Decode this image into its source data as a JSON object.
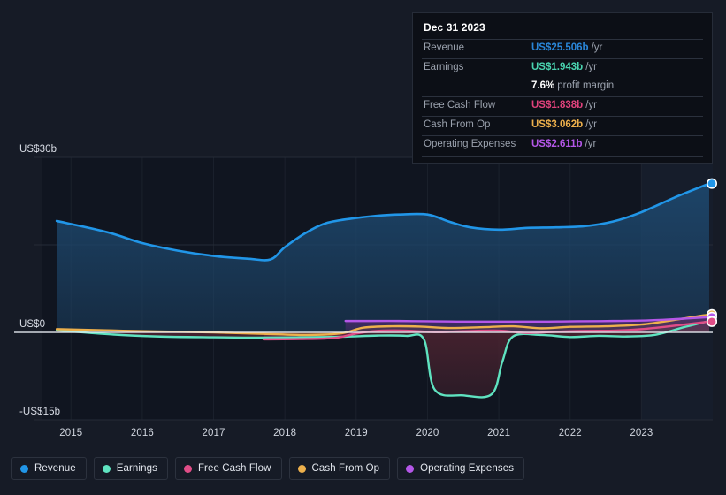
{
  "chart_data": {
    "type": "area",
    "title": "",
    "xlabel": "",
    "ylabel": "",
    "x_tick_labels": [
      "2015",
      "2016",
      "2017",
      "2018",
      "2019",
      "2020",
      "2021",
      "2022",
      "2023"
    ],
    "y_tick_labels": [
      "US$30b",
      "US$0",
      "-US$15b"
    ],
    "ylim": [
      -15,
      30
    ],
    "xlim": [
      2014.6,
      2024.0
    ],
    "grid": true,
    "legend_position": "bottom",
    "currency": "US$",
    "units": "billions",
    "series": [
      {
        "name": "Revenue",
        "color": "#2196e8",
        "fill": "#1d466b",
        "x": [
          2014.8,
          2015.5,
          2016.0,
          2016.5,
          2017.0,
          2017.5,
          2017.8,
          2018.0,
          2018.3,
          2018.6,
          2019.0,
          2019.3,
          2019.6,
          2020.0,
          2020.3,
          2020.6,
          2021.0,
          2021.4,
          2021.8,
          2022.2,
          2022.6,
          2023.0,
          2023.5,
          2023.95
        ],
        "values": [
          19.1,
          17.2,
          15.3,
          14.0,
          13.1,
          12.6,
          12.5,
          14.6,
          17.1,
          18.8,
          19.6,
          20.0,
          20.2,
          20.2,
          19.0,
          18.0,
          17.6,
          17.9,
          18.0,
          18.2,
          19.0,
          20.6,
          23.3,
          25.506
        ]
      },
      {
        "name": "Earnings",
        "color": "#5fe3c0",
        "fill": "#4b2330",
        "x": [
          2014.8,
          2015.5,
          2016.2,
          2017.0,
          2017.6,
          2018.2,
          2018.8,
          2019.3,
          2019.7,
          2019.95,
          2020.1,
          2020.5,
          2020.9,
          2021.05,
          2021.2,
          2021.6,
          2022.0,
          2022.4,
          2022.8,
          2023.2,
          2023.6,
          2023.95
        ],
        "values": [
          0.35,
          -0.3,
          -0.7,
          -0.85,
          -0.9,
          -0.85,
          -0.75,
          -0.55,
          -0.6,
          -1.2,
          -9.8,
          -10.8,
          -10.6,
          -5.0,
          -0.7,
          -0.45,
          -0.8,
          -0.6,
          -0.7,
          -0.4,
          0.9,
          1.943
        ]
      },
      {
        "name": "Free Cash Flow",
        "color": "#e04d87",
        "fill": "#6b2c48",
        "x": [
          2017.7,
          2018.2,
          2018.7,
          2019.0,
          2019.3,
          2019.7,
          2020.1,
          2020.5,
          2021.0,
          2021.4,
          2021.8,
          2022.2,
          2022.6,
          2023.0,
          2023.5,
          2023.95
        ],
        "values": [
          -1.2,
          -1.15,
          -0.95,
          -0.2,
          0.25,
          0.3,
          0.05,
          0.2,
          0.3,
          -0.1,
          0.1,
          0.25,
          0.3,
          0.55,
          1.2,
          1.838
        ]
      },
      {
        "name": "Cash From Op",
        "color": "#edb04c",
        "fill": "#6b5428",
        "x": [
          2014.8,
          2015.5,
          2016.2,
          2017.0,
          2017.7,
          2018.3,
          2018.8,
          2019.1,
          2019.5,
          2019.9,
          2020.3,
          2020.8,
          2021.2,
          2021.6,
          2022.0,
          2022.5,
          2023.0,
          2023.5,
          2023.95
        ],
        "values": [
          0.55,
          0.35,
          0.15,
          0.0,
          -0.25,
          -0.45,
          -0.15,
          0.8,
          1.05,
          1.0,
          0.75,
          0.9,
          1.05,
          0.7,
          0.95,
          1.05,
          1.35,
          2.2,
          3.062
        ]
      },
      {
        "name": "Operating Expenses",
        "color": "#b457e8",
        "fill": "#4a2a6b",
        "x": [
          2018.85,
          2019.2,
          2019.6,
          2020.0,
          2020.4,
          2020.9,
          2021.3,
          2021.7,
          2022.1,
          2022.6,
          2023.1,
          2023.6,
          2023.95
        ],
        "values": [
          1.95,
          1.95,
          1.95,
          1.9,
          1.85,
          1.85,
          1.85,
          1.85,
          1.9,
          1.95,
          2.05,
          2.35,
          2.611
        ]
      }
    ],
    "endpoint_markers": [
      {
        "series": "Revenue",
        "value": 25.506
      },
      {
        "series": "Cash From Op",
        "value": 3.062
      },
      {
        "series": "Operating Expenses",
        "value": 2.611
      },
      {
        "series": "Earnings",
        "value": 1.943
      },
      {
        "series": "Free Cash Flow",
        "value": 1.838
      }
    ]
  },
  "tooltip": {
    "title": "Dec 31 2023",
    "rows": [
      {
        "label": "Revenue",
        "value": "US$25.506b",
        "suffix": "/yr",
        "color": "#2a86d8"
      },
      {
        "label": "Earnings",
        "value": "US$1.943b",
        "suffix": "/yr",
        "color": "#4ad4b0"
      },
      {
        "label": "",
        "value": "7.6%",
        "suffix": "profit margin",
        "color": "#ffffff"
      },
      {
        "label": "Free Cash Flow",
        "value": "US$1.838b",
        "suffix": "/yr",
        "color": "#e0427c"
      },
      {
        "label": "Cash From Op",
        "value": "US$3.062b",
        "suffix": "/yr",
        "color": "#edb04c"
      },
      {
        "label": "Operating Expenses",
        "value": "US$2.611b",
        "suffix": "/yr",
        "color": "#b457e8"
      }
    ]
  },
  "legend": {
    "items": [
      {
        "label": "Revenue",
        "color": "#2196e8"
      },
      {
        "label": "Earnings",
        "color": "#5fe3c0"
      },
      {
        "label": "Free Cash Flow",
        "color": "#e04d87"
      },
      {
        "label": "Cash From Op",
        "color": "#edb04c"
      },
      {
        "label": "Operating Expenses",
        "color": "#b457e8"
      }
    ]
  },
  "axes": {
    "y_ticks": [
      {
        "label": "US$30b",
        "value": 30
      },
      {
        "label": "US$0",
        "value": 0
      },
      {
        "label": "-US$15b",
        "value": -15
      }
    ],
    "x_ticks": [
      {
        "label": "2015",
        "value": 2015
      },
      {
        "label": "2016",
        "value": 2016
      },
      {
        "label": "2017",
        "value": 2017
      },
      {
        "label": "2018",
        "value": 2018
      },
      {
        "label": "2019",
        "value": 2019
      },
      {
        "label": "2020",
        "value": 2020
      },
      {
        "label": "2021",
        "value": 2021
      },
      {
        "label": "2022",
        "value": 2022
      },
      {
        "label": "2023",
        "value": 2023
      }
    ]
  },
  "theme": {
    "background": "#161b26",
    "plot_background": "#101520",
    "gridline": "#252b37",
    "zero_line": "#e9edf4",
    "forecast_band": "#1b2d42"
  }
}
